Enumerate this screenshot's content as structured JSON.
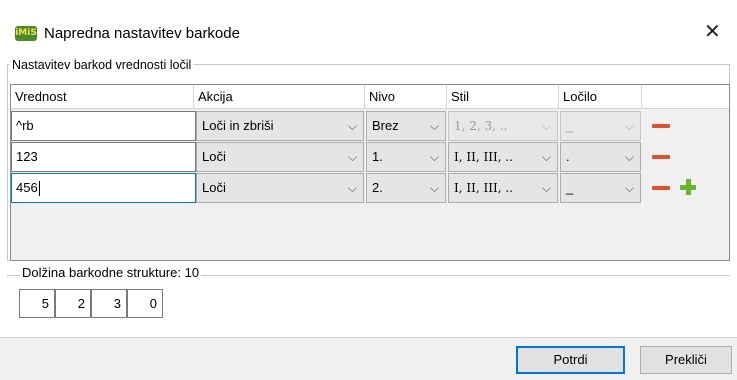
{
  "window": {
    "title": "Napredna nastavitev barkode",
    "app_icon_text": "iMiS",
    "close_glyph": "✕"
  },
  "group": {
    "legend": "Nastavitev barkod vrednosti ločil"
  },
  "table": {
    "headers": [
      "Vrednost",
      "Akcija",
      "Nivo",
      "Stil",
      "Ločilo"
    ],
    "rows": [
      {
        "vrednost": "^rb",
        "akcija": "Loči in zbriši",
        "nivo": "Brez",
        "stil": "1, 2, 3, ..",
        "locilo": "_",
        "stil_disabled": true,
        "locilo_disabled": true
      },
      {
        "vrednost": "123",
        "akcija": "Loči",
        "nivo": "1.",
        "stil": "I, II, III, ..",
        "locilo": ".",
        "stil_disabled": false,
        "locilo_disabled": false
      },
      {
        "vrednost": "456",
        "akcija": "Loči",
        "nivo": "2.",
        "stil": "I, II, III, ..",
        "locilo": "_",
        "stil_disabled": false,
        "locilo_disabled": false
      }
    ],
    "row_action_icon": "minus-icon",
    "add_action_icon": "plus-icon"
  },
  "length": {
    "label": "Dolžina barkodne strukture: 10",
    "values": [
      "5",
      "2",
      "3",
      "0"
    ]
  },
  "buttons": {
    "confirm": "Potrdi",
    "cancel": "Prekliči"
  },
  "colors": {
    "focus_border": "#0078d7",
    "minus": "#e0502a",
    "plus": "#6ab52e"
  }
}
